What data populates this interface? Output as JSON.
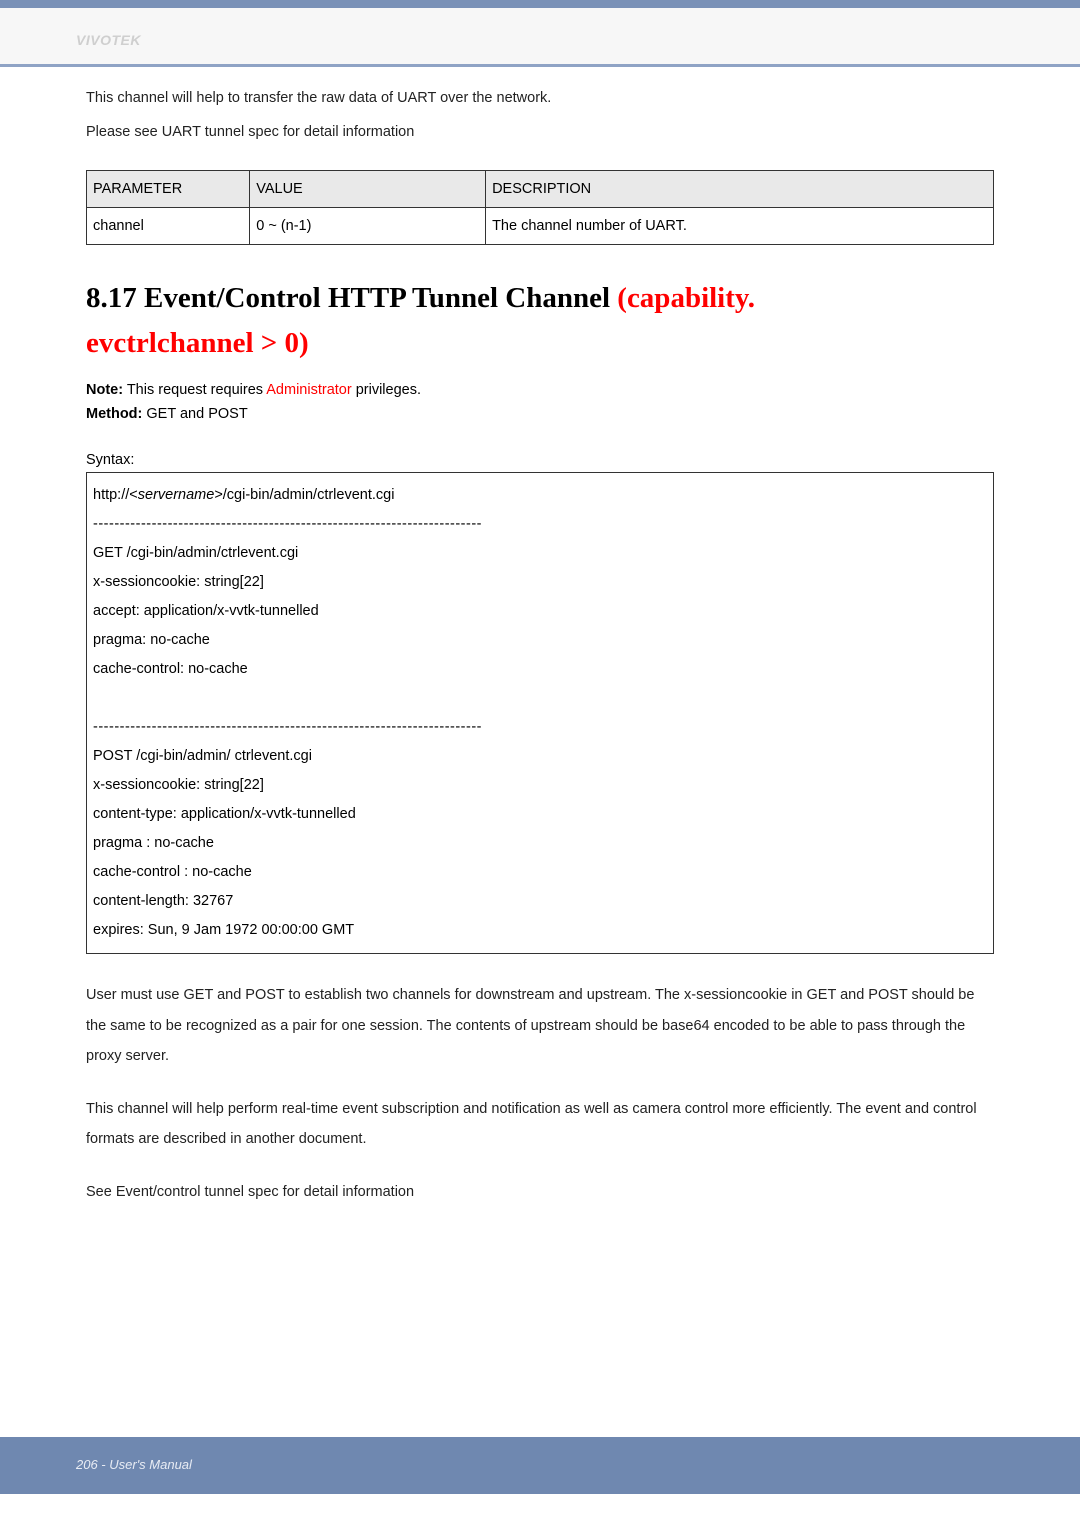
{
  "header": {
    "brand": "VIVOTEK"
  },
  "intro": {
    "line1": "This channel will help to transfer the raw data of UART over the network.",
    "line2": "Please see UART tunnel spec for detail information"
  },
  "params_table": {
    "headers": [
      "PARAMETER",
      "VALUE",
      "DESCRIPTION"
    ],
    "rows": [
      {
        "param": "channel",
        "value": "0 ~ (n-1)",
        "desc": "The channel number of UART."
      }
    ]
  },
  "section": {
    "title_black": "8.17 Event/Control HTTP Tunnel Channel ",
    "title_red1": "(capability.",
    "title_red2": "evctrlchannel > 0)"
  },
  "note": {
    "label": "Note:",
    "before": " This request requires ",
    "red": "Administrator",
    "after": " privileges."
  },
  "method": {
    "label": "Method:",
    "value": " GET and POST"
  },
  "syntax_label": "Syntax:",
  "code": {
    "l1_pre": "http://<",
    "l1_it": "servername",
    "l1_post": ">/cgi-bin/admin/ctrlevent.cgi",
    "sep": "-------------------------------------------------------------------------",
    "g1": "GET /cgi-bin/admin/ctrlevent.cgi",
    "g2": "x-sessioncookie: string[22]",
    "g3": "accept: application/x-vvtk-tunnelled",
    "g4": "pragma: no-cache",
    "g5": "cache-control: no-cache",
    "p1": "POST /cgi-bin/admin/ ctrlevent.cgi",
    "p2": "x-sessioncookie: string[22]",
    "p3": "content-type: application/x-vvtk-tunnelled",
    "p4": "pragma : no-cache",
    "p5": "cache-control : no-cache",
    "p6": "content-length: 32767",
    "p7": "expires: Sun, 9 Jam 1972 00:00:00 GMT"
  },
  "post": {
    "para1": "User must use GET and POST to establish two channels for downstream and upstream. The x-sessioncookie in GET and POST should be the same to be recognized as a pair for one session. The contents of upstream should be base64 encoded to be able to pass through the proxy server.",
    "para2": "This channel will help perform real-time event subscription and notification as well as camera control more efficiently. The event and control formats are described in another document.",
    "para3": "See Event/control tunnel spec for detail information"
  },
  "footer": {
    "text": "206 - User's Manual"
  }
}
